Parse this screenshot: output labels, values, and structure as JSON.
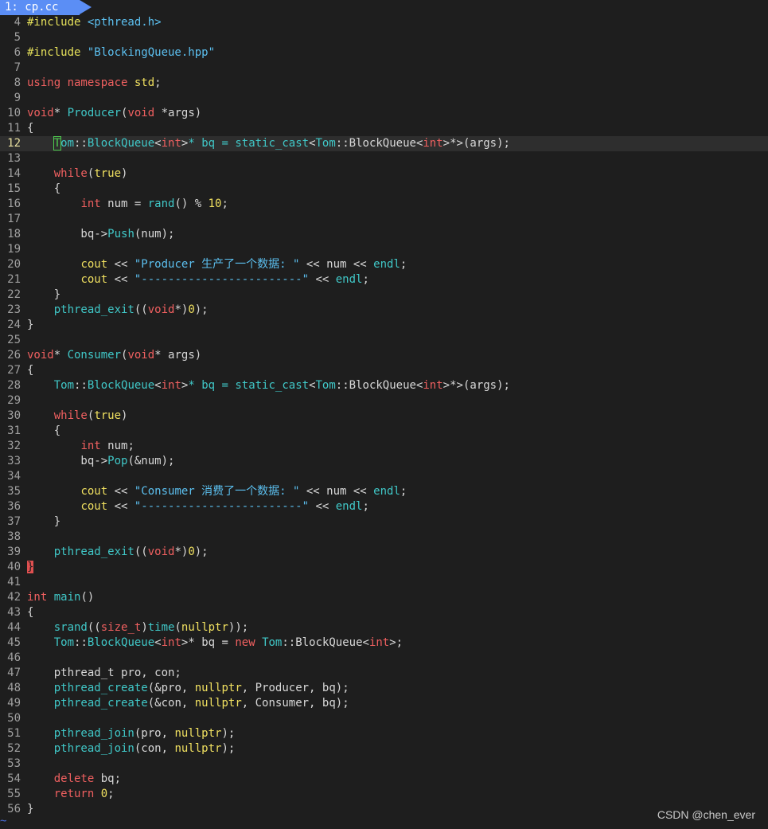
{
  "tab": {
    "label": "1: cp.cc"
  },
  "watermark": "CSDN @chen_ever",
  "end_marker": "~",
  "colors": {
    "background": "#1e1e1e",
    "tab": "#5b8ef5",
    "keyword": "#f06060",
    "function": "#40c8c8",
    "string": "#5cc0f0",
    "literal": "#f0e060",
    "line_number": "#a0a0a0"
  },
  "lines": [
    {
      "n": "4",
      "current": false,
      "segs": [
        [
          "cp",
          "#include "
        ],
        [
          "cs",
          "<pthread.h>"
        ]
      ]
    },
    {
      "n": "5",
      "current": false,
      "segs": []
    },
    {
      "n": "6",
      "current": false,
      "segs": [
        [
          "cp",
          "#include "
        ],
        [
          "cs",
          "\"BlockingQueue.hpp\""
        ]
      ]
    },
    {
      "n": "7",
      "current": false,
      "segs": []
    },
    {
      "n": "8",
      "current": false,
      "segs": [
        [
          "ck",
          "using namespace "
        ],
        [
          "cy",
          "std"
        ],
        [
          "cm",
          ";"
        ]
      ]
    },
    {
      "n": "9",
      "current": false,
      "segs": []
    },
    {
      "n": "10",
      "current": false,
      "segs": [
        [
          "ck",
          "void"
        ],
        [
          "cm",
          "* "
        ],
        [
          "cf",
          "Producer"
        ],
        [
          "cm",
          "("
        ],
        [
          "ck",
          "void"
        ],
        [
          "cm",
          " *args)"
        ]
      ]
    },
    {
      "n": "11",
      "current": false,
      "segs": [
        [
          "cm",
          "{"
        ]
      ]
    },
    {
      "n": "12",
      "current": true,
      "segs": [
        [
          "cm",
          "    "
        ],
        [
          "cursor",
          "T"
        ],
        [
          "cf",
          "om"
        ],
        [
          "cm",
          "::"
        ],
        [
          "cf",
          "BlockQueue"
        ],
        [
          "cm",
          "<"
        ],
        [
          "ck",
          "int"
        ],
        [
          "cm",
          ">"
        ],
        [
          "cf",
          "* bq = static_cast"
        ],
        [
          "cm",
          "<"
        ],
        [
          "cf",
          "Tom"
        ],
        [
          "cm",
          "::BlockQueue<"
        ],
        [
          "ck",
          "int"
        ],
        [
          "cm",
          ">*>(args);"
        ]
      ]
    },
    {
      "n": "13",
      "current": false,
      "segs": []
    },
    {
      "n": "14",
      "current": false,
      "segs": [
        [
          "cm",
          "    "
        ],
        [
          "ck",
          "while"
        ],
        [
          "cm",
          "("
        ],
        [
          "cy",
          "true"
        ],
        [
          "cm",
          ")"
        ]
      ]
    },
    {
      "n": "15",
      "current": false,
      "segs": [
        [
          "cm",
          "    {"
        ]
      ]
    },
    {
      "n": "16",
      "current": false,
      "segs": [
        [
          "cm",
          "        "
        ],
        [
          "ck",
          "int"
        ],
        [
          "cm",
          " num = "
        ],
        [
          "cf",
          "rand"
        ],
        [
          "cm",
          "() % "
        ],
        [
          "cy",
          "10"
        ],
        [
          "cm",
          ";"
        ]
      ]
    },
    {
      "n": "17",
      "current": false,
      "segs": []
    },
    {
      "n": "18",
      "current": false,
      "segs": [
        [
          "cm",
          "        bq->"
        ],
        [
          "cf",
          "Push"
        ],
        [
          "cm",
          "(num);"
        ]
      ]
    },
    {
      "n": "19",
      "current": false,
      "segs": []
    },
    {
      "n": "20",
      "current": false,
      "segs": [
        [
          "cm",
          "        "
        ],
        [
          "cy",
          "cout"
        ],
        [
          "cm",
          " << "
        ],
        [
          "cs",
          "\"Producer 生产了一个数据: \""
        ],
        [
          "cm",
          " << num << "
        ],
        [
          "cf",
          "endl"
        ],
        [
          "cm",
          ";"
        ]
      ]
    },
    {
      "n": "21",
      "current": false,
      "segs": [
        [
          "cm",
          "        "
        ],
        [
          "cy",
          "cout"
        ],
        [
          "cm",
          " << "
        ],
        [
          "cs",
          "\"------------------------\""
        ],
        [
          "cm",
          " << "
        ],
        [
          "cf",
          "endl"
        ],
        [
          "cm",
          ";"
        ]
      ]
    },
    {
      "n": "22",
      "current": false,
      "segs": [
        [
          "cm",
          "    }"
        ]
      ]
    },
    {
      "n": "23",
      "current": false,
      "segs": [
        [
          "cm",
          "    "
        ],
        [
          "cf",
          "pthread_exit"
        ],
        [
          "cm",
          "(("
        ],
        [
          "ck",
          "void"
        ],
        [
          "cm",
          "*)"
        ],
        [
          "cy",
          "0"
        ],
        [
          "cm",
          ");"
        ]
      ]
    },
    {
      "n": "24",
      "current": false,
      "segs": [
        [
          "cm",
          "}"
        ]
      ]
    },
    {
      "n": "25",
      "current": false,
      "segs": []
    },
    {
      "n": "26",
      "current": false,
      "segs": [
        [
          "ck",
          "void"
        ],
        [
          "cm",
          "* "
        ],
        [
          "cf",
          "Consumer"
        ],
        [
          "cm",
          "("
        ],
        [
          "ck",
          "void"
        ],
        [
          "cm",
          "* args)"
        ]
      ]
    },
    {
      "n": "27",
      "current": false,
      "segs": [
        [
          "cm",
          "{"
        ]
      ]
    },
    {
      "n": "28",
      "current": false,
      "segs": [
        [
          "cm",
          "    "
        ],
        [
          "cf",
          "Tom"
        ],
        [
          "cm",
          "::"
        ],
        [
          "cf",
          "BlockQueue"
        ],
        [
          "cm",
          "<"
        ],
        [
          "ck",
          "int"
        ],
        [
          "cm",
          ">"
        ],
        [
          "cf",
          "* bq = static_cast"
        ],
        [
          "cm",
          "<"
        ],
        [
          "cf",
          "Tom"
        ],
        [
          "cm",
          "::BlockQueue<"
        ],
        [
          "ck",
          "int"
        ],
        [
          "cm",
          ">*>(args);"
        ]
      ]
    },
    {
      "n": "29",
      "current": false,
      "segs": []
    },
    {
      "n": "30",
      "current": false,
      "segs": [
        [
          "cm",
          "    "
        ],
        [
          "ck",
          "while"
        ],
        [
          "cm",
          "("
        ],
        [
          "cy",
          "true"
        ],
        [
          "cm",
          ")"
        ]
      ]
    },
    {
      "n": "31",
      "current": false,
      "segs": [
        [
          "cm",
          "    {"
        ]
      ]
    },
    {
      "n": "32",
      "current": false,
      "segs": [
        [
          "cm",
          "        "
        ],
        [
          "ck",
          "int"
        ],
        [
          "cm",
          " num;"
        ]
      ]
    },
    {
      "n": "33",
      "current": false,
      "segs": [
        [
          "cm",
          "        bq->"
        ],
        [
          "cf",
          "Pop"
        ],
        [
          "cm",
          "(&num);"
        ]
      ]
    },
    {
      "n": "34",
      "current": false,
      "segs": []
    },
    {
      "n": "35",
      "current": false,
      "segs": [
        [
          "cm",
          "        "
        ],
        [
          "cy",
          "cout"
        ],
        [
          "cm",
          " << "
        ],
        [
          "cs",
          "\"Consumer 消费了一个数据: \""
        ],
        [
          "cm",
          " << num << "
        ],
        [
          "cf",
          "endl"
        ],
        [
          "cm",
          ";"
        ]
      ]
    },
    {
      "n": "36",
      "current": false,
      "segs": [
        [
          "cm",
          "        "
        ],
        [
          "cy",
          "cout"
        ],
        [
          "cm",
          " << "
        ],
        [
          "cs",
          "\"------------------------\""
        ],
        [
          "cm",
          " << "
        ],
        [
          "cf",
          "endl"
        ],
        [
          "cm",
          ";"
        ]
      ]
    },
    {
      "n": "37",
      "current": false,
      "segs": [
        [
          "cm",
          "    }"
        ]
      ]
    },
    {
      "n": "38",
      "current": false,
      "segs": []
    },
    {
      "n": "39",
      "current": false,
      "segs": [
        [
          "cm",
          "    "
        ],
        [
          "cf",
          "pthread_exit"
        ],
        [
          "cm",
          "(("
        ],
        [
          "ck",
          "void"
        ],
        [
          "cm",
          "*)"
        ],
        [
          "cy",
          "0"
        ],
        [
          "cm",
          ");"
        ]
      ]
    },
    {
      "n": "40",
      "current": false,
      "segs": [
        [
          "match",
          "}"
        ]
      ]
    },
    {
      "n": "41",
      "current": false,
      "segs": []
    },
    {
      "n": "42",
      "current": false,
      "segs": [
        [
          "ck",
          "int"
        ],
        [
          "cm",
          " "
        ],
        [
          "cf",
          "main"
        ],
        [
          "cm",
          "()"
        ]
      ]
    },
    {
      "n": "43",
      "current": false,
      "segs": [
        [
          "cm",
          "{"
        ]
      ]
    },
    {
      "n": "44",
      "current": false,
      "segs": [
        [
          "cm",
          "    "
        ],
        [
          "cf",
          "srand"
        ],
        [
          "cm",
          "(("
        ],
        [
          "ck",
          "size_t"
        ],
        [
          "cm",
          ")"
        ],
        [
          "cf",
          "time"
        ],
        [
          "cm",
          "("
        ],
        [
          "cy",
          "nullptr"
        ],
        [
          "cm",
          "));"
        ]
      ]
    },
    {
      "n": "45",
      "current": false,
      "segs": [
        [
          "cm",
          "    "
        ],
        [
          "cf",
          "Tom"
        ],
        [
          "cm",
          "::"
        ],
        [
          "cf",
          "BlockQueue"
        ],
        [
          "cm",
          "<"
        ],
        [
          "ck",
          "int"
        ],
        [
          "cm",
          ">* bq = "
        ],
        [
          "ck",
          "new"
        ],
        [
          "cm",
          " "
        ],
        [
          "cf",
          "Tom"
        ],
        [
          "cm",
          "::BlockQueue<"
        ],
        [
          "ck",
          "int"
        ],
        [
          "cm",
          ">;"
        ]
      ]
    },
    {
      "n": "46",
      "current": false,
      "segs": []
    },
    {
      "n": "47",
      "current": false,
      "segs": [
        [
          "cm",
          "    pthread_t pro, con;"
        ]
      ]
    },
    {
      "n": "48",
      "current": false,
      "segs": [
        [
          "cm",
          "    "
        ],
        [
          "cf",
          "pthread_create"
        ],
        [
          "cm",
          "(&pro, "
        ],
        [
          "cy",
          "nullptr"
        ],
        [
          "cm",
          ", Producer, bq);"
        ]
      ]
    },
    {
      "n": "49",
      "current": false,
      "segs": [
        [
          "cm",
          "    "
        ],
        [
          "cf",
          "pthread_create"
        ],
        [
          "cm",
          "(&con, "
        ],
        [
          "cy",
          "nullptr"
        ],
        [
          "cm",
          ", Consumer, bq);"
        ]
      ]
    },
    {
      "n": "50",
      "current": false,
      "segs": []
    },
    {
      "n": "51",
      "current": false,
      "segs": [
        [
          "cm",
          "    "
        ],
        [
          "cf",
          "pthread_join"
        ],
        [
          "cm",
          "(pro, "
        ],
        [
          "cy",
          "nullptr"
        ],
        [
          "cm",
          ");"
        ]
      ]
    },
    {
      "n": "52",
      "current": false,
      "segs": [
        [
          "cm",
          "    "
        ],
        [
          "cf",
          "pthread_join"
        ],
        [
          "cm",
          "(con, "
        ],
        [
          "cy",
          "nullptr"
        ],
        [
          "cm",
          ");"
        ]
      ]
    },
    {
      "n": "53",
      "current": false,
      "segs": []
    },
    {
      "n": "54",
      "current": false,
      "segs": [
        [
          "cm",
          "    "
        ],
        [
          "ck",
          "delete"
        ],
        [
          "cm",
          " bq;"
        ]
      ]
    },
    {
      "n": "55",
      "current": false,
      "segs": [
        [
          "cm",
          "    "
        ],
        [
          "ck",
          "return"
        ],
        [
          "cm",
          " "
        ],
        [
          "cy",
          "0"
        ],
        [
          "cm",
          ";"
        ]
      ]
    },
    {
      "n": "56",
      "current": false,
      "segs": [
        [
          "cm",
          "}"
        ]
      ]
    }
  ]
}
